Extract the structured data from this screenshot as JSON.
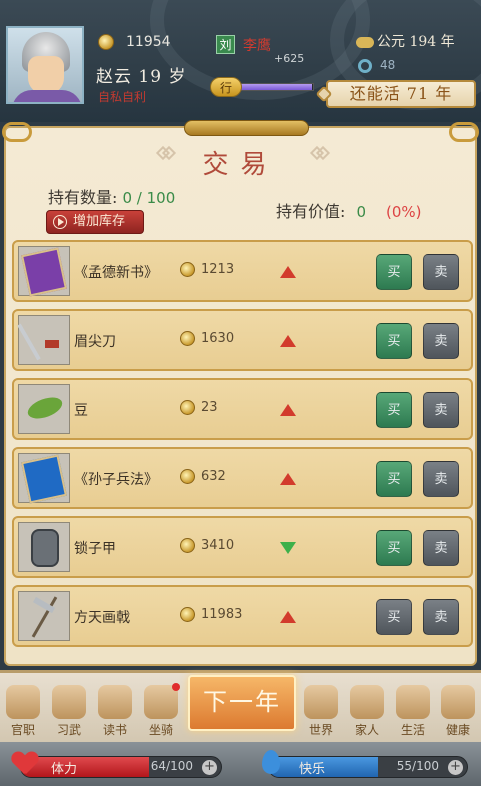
{
  "header": {
    "money": "11954",
    "name": "赵云 19 岁",
    "trait": "自私自利",
    "faction_tag": "刘",
    "ruler": "李鹰",
    "ruler_delta": "+625",
    "xing_label": "行",
    "xing_progress": 0.98,
    "year": "公元 194 年",
    "gems": "48",
    "remaining": "还能活 71 年"
  },
  "trade": {
    "title": "交易",
    "hold_qty_label": "持有数量: ",
    "hold_qty_value": "0 / 100",
    "hold_val_label": "持有价值: ",
    "hold_val_value": "0",
    "hold_val_pct": "(0%)",
    "add_stock": "增加库存",
    "buy_label": "买",
    "sell_label": "卖",
    "items": [
      {
        "name": "《孟德新书》",
        "price": "1213",
        "trend": "up",
        "buyable": true,
        "icon": "book-purple-icon"
      },
      {
        "name": "眉尖刀",
        "price": "1630",
        "trend": "up",
        "buyable": true,
        "icon": "blade-icon"
      },
      {
        "name": "豆",
        "price": "23",
        "trend": "up",
        "buyable": true,
        "icon": "beans-icon"
      },
      {
        "name": "《孙子兵法》",
        "price": "632",
        "trend": "up",
        "buyable": true,
        "icon": "book-blue-icon"
      },
      {
        "name": "锁子甲",
        "price": "3410",
        "trend": "down",
        "buyable": true,
        "icon": "armor-icon"
      },
      {
        "name": "方天画戟",
        "price": "11983",
        "trend": "up",
        "buyable": false,
        "icon": "halberd-icon"
      }
    ]
  },
  "nav": {
    "items": [
      "官职",
      "习武",
      "读书",
      "坐骑",
      "世界",
      "家人",
      "生活",
      "健康"
    ],
    "next_year": "下一年"
  },
  "status": {
    "stamina_label": "体力",
    "stamina_value": "64/100",
    "stamina_ratio": 0.64,
    "joy_label": "快乐",
    "joy_value": "55/100",
    "joy_ratio": 0.55,
    "plus": "+"
  },
  "colors": {
    "buy_green": "#2d7a50",
    "up_red": "#d23b2c",
    "down_green": "#3db04a",
    "stamina_red": "#c8262b",
    "joy_blue": "#2f78c4"
  }
}
